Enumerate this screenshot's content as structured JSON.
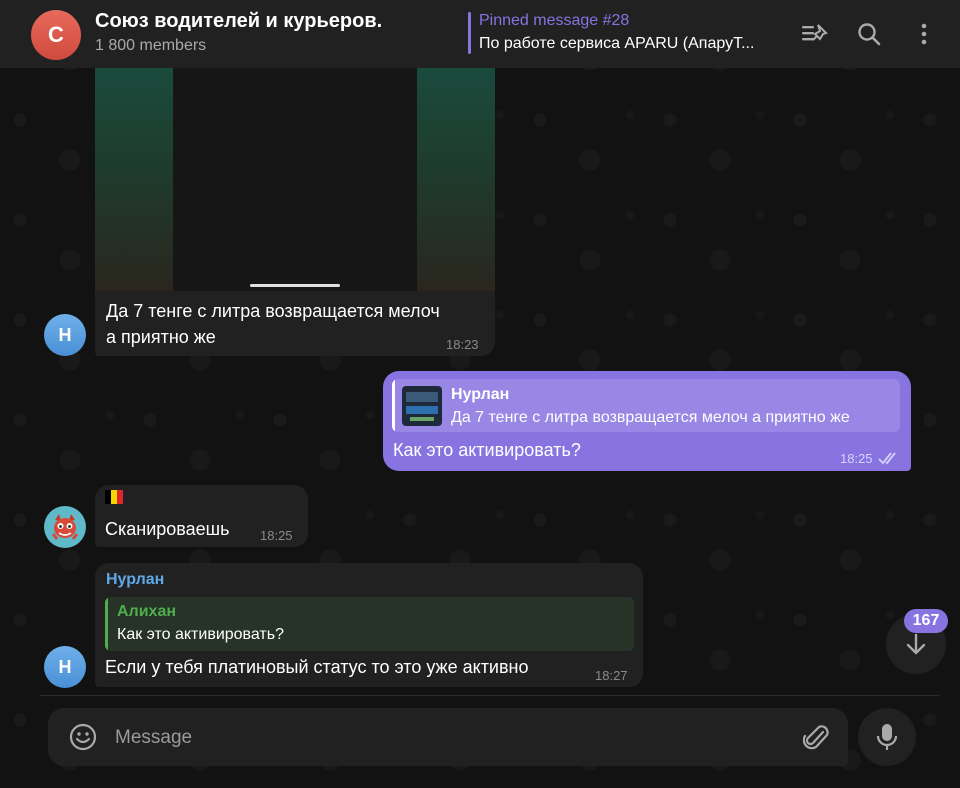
{
  "header": {
    "avatar_letter": "С",
    "title": "Союз водителей и курьеров.",
    "subtitle": "1 800 members",
    "pinned_title": "Pinned message #28",
    "pinned_text": "По работе сервиса APARU (АпаруТ..."
  },
  "messages": [
    {
      "avatar_letter": "Н",
      "text_line1": "Да 7 тенге с литра возвращается мелоч",
      "text_line2": "а приятно же",
      "time": "18:23"
    },
    {
      "reply_name": "Нурлан",
      "reply_text": "Да 7 тенге с литра возвращается мелоч а приятно же",
      "text": "Как это активировать?",
      "time": "18:25"
    },
    {
      "flag": "🇧🇪",
      "text": "Сканироваешь",
      "time": "18:25"
    },
    {
      "avatar_letter": "Н",
      "sender": "Нурлан",
      "reply_name": "Алихан",
      "reply_text": "Как это активировать?",
      "text": "Если у тебя платиновый статус то это уже активно",
      "time": "18:27"
    }
  ],
  "unread_count": "167",
  "composer": {
    "placeholder": "Message"
  },
  "colors": {
    "accent": "#8774e1",
    "reply_green": "#4fae4e",
    "sender_blue": "#5fa8e8"
  },
  "icons": [
    "unpin-icon",
    "search-icon",
    "more-vertical-icon",
    "emoji-icon",
    "attach-icon",
    "mic-icon",
    "arrow-down-icon",
    "double-check-icon"
  ]
}
